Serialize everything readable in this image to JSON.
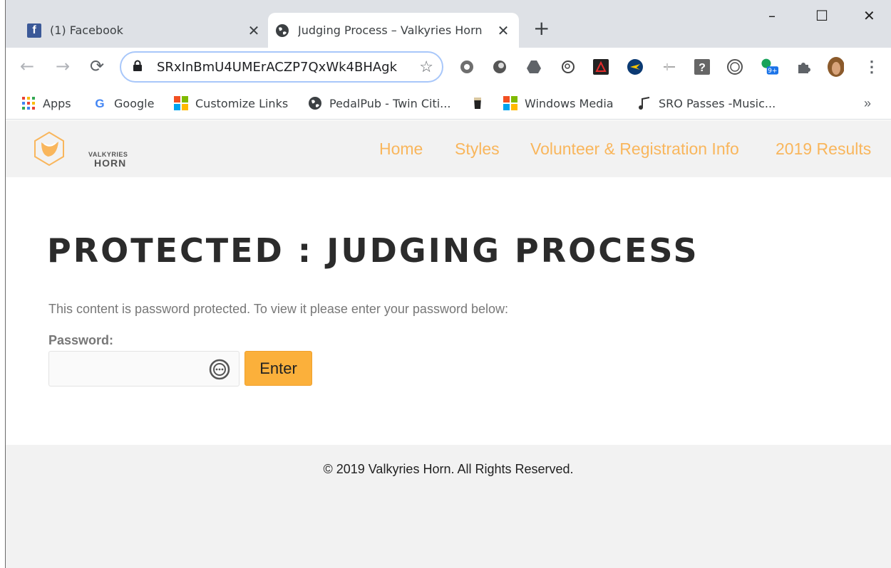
{
  "browser": {
    "tabs": [
      {
        "title": "(1) Facebook",
        "icon": "facebook-icon",
        "active": false
      },
      {
        "title": "Judging Process – Valkyries Horn",
        "icon": "globe-icon",
        "active": true
      }
    ],
    "new_tab_glyph": "+",
    "window_controls": {
      "minimize": "–",
      "maximize": "☐",
      "close": "✕"
    },
    "nav": {
      "back": "←",
      "forward": "→",
      "reload": "⟳"
    },
    "address": "SRxInBmU4UMErACZP7QxWk4BHAgk",
    "extensions_badge": "9+",
    "bookmarks": [
      {
        "label": "Apps",
        "icon": "apps-grid-icon"
      },
      {
        "label": "Google",
        "icon": "google-icon"
      },
      {
        "label": "Customize Links",
        "icon": "windows-icon"
      },
      {
        "label": "PedalPub - Twin Citi...",
        "icon": "globe-icon"
      },
      {
        "label": "",
        "icon": "beer-icon"
      },
      {
        "label": "Windows Media",
        "icon": "windows-icon"
      },
      {
        "label": "SRO Passes -Music...",
        "icon": "music-note-icon"
      }
    ],
    "bookmarks_more": "»"
  },
  "site": {
    "logo": {
      "line1": "VALKYRIES",
      "line2": "HORN"
    },
    "nav": [
      "Home",
      "Styles",
      "Volunteer & Registration Info",
      "2019 Results"
    ],
    "accent": "#f9b65c",
    "title": "PROTECTED : JUDGING PROCESS",
    "notice": "This content is password protected. To view it please enter your password below:",
    "password_label": "Password:",
    "password_value": "",
    "enter_label": "Enter",
    "footer": "© 2019 Valkyries Horn. All Rights Reserved."
  }
}
